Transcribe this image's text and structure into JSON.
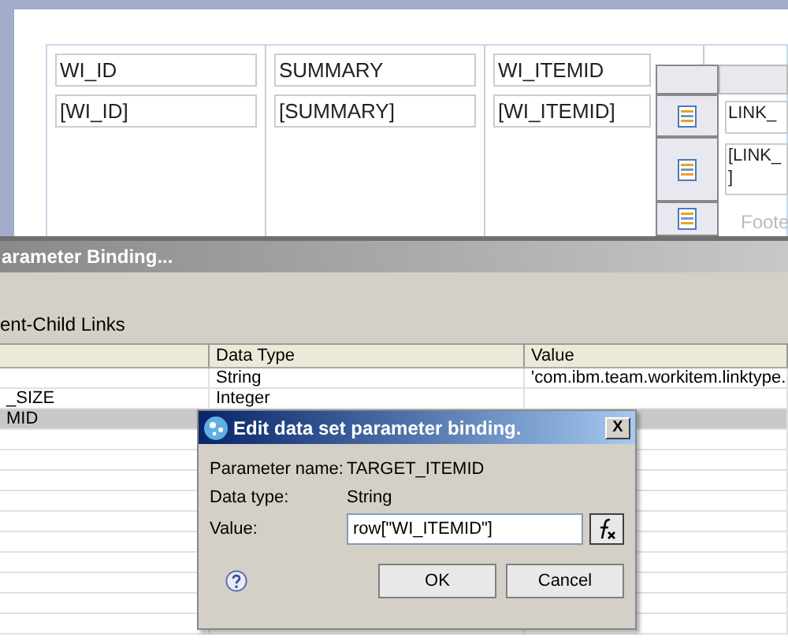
{
  "report": {
    "headers": [
      "WI_ID",
      "SUMMARY",
      "WI_ITEMID"
    ],
    "details": [
      "[WI_ID]",
      "[SUMMARY]",
      "[WI_ITEMID]"
    ]
  },
  "nested_table": {
    "rows": [
      {
        "kind": "header",
        "text": "LINK_"
      },
      {
        "kind": "detail",
        "text": "[LINK_\n]"
      },
      {
        "kind": "footer",
        "text": "Foote"
      }
    ]
  },
  "binding_window": {
    "title": "arameter Binding...",
    "section": "ent-Child Links",
    "columns": [
      "",
      "Data Type",
      "Value"
    ],
    "rows": [
      {
        "cells": [
          "",
          "String",
          "'com.ibm.team.workitem.linktype."
        ],
        "selected": false
      },
      {
        "cells": [
          "_SIZE",
          "Integer",
          ""
        ],
        "selected": false
      },
      {
        "cells": [
          "MID",
          "",
          ""
        ],
        "selected": true
      }
    ]
  },
  "dialog": {
    "title": "Edit data set parameter binding.",
    "close": "X",
    "fields": [
      {
        "label": "Parameter name:",
        "text": "TARGET_ITEMID"
      },
      {
        "label": "Data type:",
        "text": "String"
      }
    ],
    "value_label": "Value:",
    "value": "row[\"WI_ITEMID\"]",
    "buttons": [
      "OK",
      "Cancel"
    ]
  }
}
